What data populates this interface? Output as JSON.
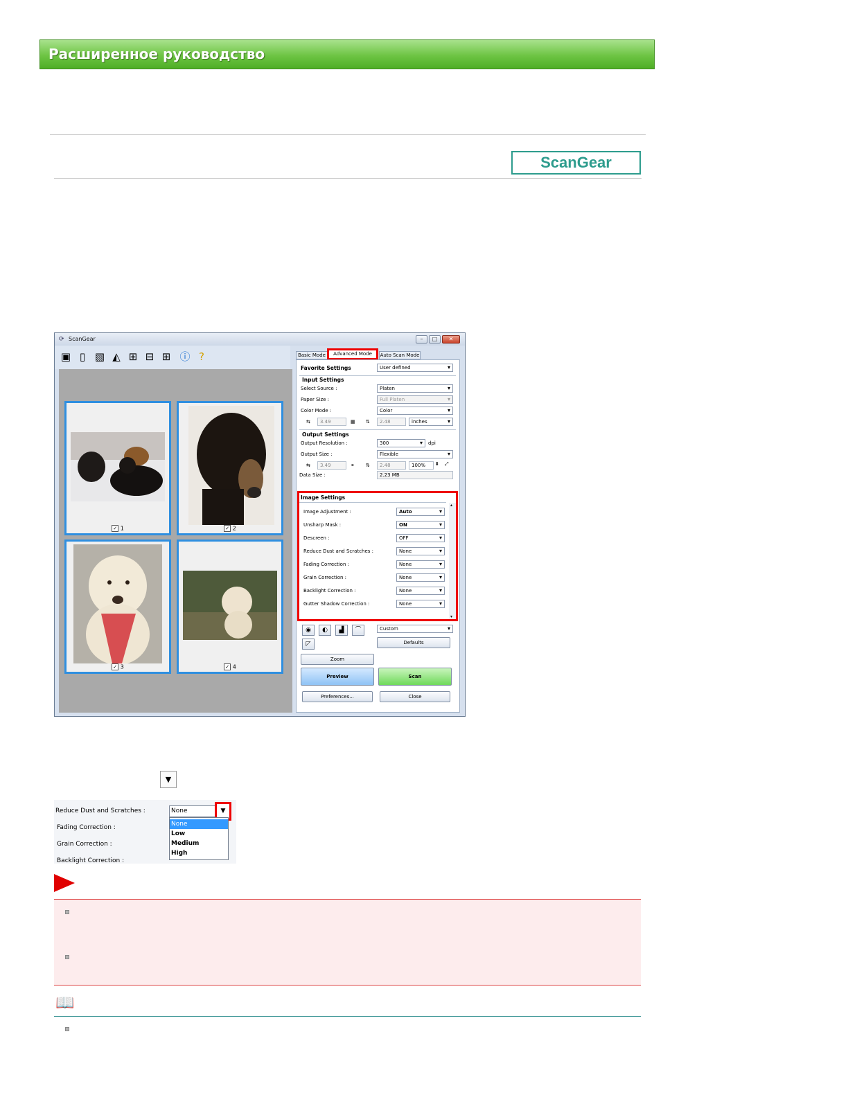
{
  "banner": {
    "title": "Расширенное руководство"
  },
  "badge": {
    "label": "ScanGear"
  },
  "window": {
    "title": "ScanGear",
    "controls": {
      "minimize": "–",
      "maximize": "□",
      "close": "✕"
    },
    "tabs": [
      "Basic Mode",
      "Advanced Mode",
      "Auto Scan Mode"
    ],
    "thumbnails": [
      {
        "checkbox_label": "1"
      },
      {
        "checkbox_label": "2"
      },
      {
        "checkbox_label": "3"
      },
      {
        "checkbox_label": "4"
      }
    ],
    "favorite": {
      "label": "Favorite Settings",
      "value": "User defined"
    },
    "input_settings": {
      "header": "Input Settings",
      "select_source": {
        "label": "Select Source :",
        "value": "Platen"
      },
      "paper_size": {
        "label": "Paper Size :",
        "value": "Full Platen"
      },
      "color_mode": {
        "label": "Color Mode :",
        "value": "Color"
      },
      "width": "3.49",
      "height": "2.48",
      "unit": "inches"
    },
    "output_settings": {
      "header": "Output Settings",
      "resolution": {
        "label": "Output Resolution :",
        "value": "300",
        "unit": "dpi"
      },
      "size": {
        "label": "Output Size :",
        "value": "Flexible"
      },
      "width": "3.49",
      "height": "2.48",
      "scale": "100%",
      "data_size": {
        "label": "Data Size :",
        "value": "2.23 MB"
      }
    },
    "image_settings": {
      "header": "Image Settings",
      "rows": [
        {
          "label": "Image Adjustment :",
          "value": "Auto"
        },
        {
          "label": "Unsharp Mask :",
          "value": "ON"
        },
        {
          "label": "Descreen :",
          "value": "OFF"
        },
        {
          "label": "Reduce Dust and Scratches :",
          "value": "None"
        },
        {
          "label": "Fading Correction :",
          "value": "None"
        },
        {
          "label": "Grain Correction :",
          "value": "None"
        },
        {
          "label": "Backlight Correction :",
          "value": "None"
        },
        {
          "label": "Gutter Shadow Correction :",
          "value": "None"
        }
      ]
    },
    "tone": {
      "value": "Custom",
      "defaults": "Defaults"
    },
    "buttons": {
      "zoom": "Zoom",
      "preview": "Preview",
      "scan": "Scan",
      "preferences": "Preferences...",
      "close": "Close"
    }
  },
  "dropdown_example": {
    "labels": [
      "Reduce Dust and Scratches :",
      "Fading Correction :",
      "Grain Correction :",
      "Backlight Correction :"
    ],
    "selected": "None",
    "options": [
      "None",
      "Low",
      "Medium",
      "High"
    ]
  }
}
